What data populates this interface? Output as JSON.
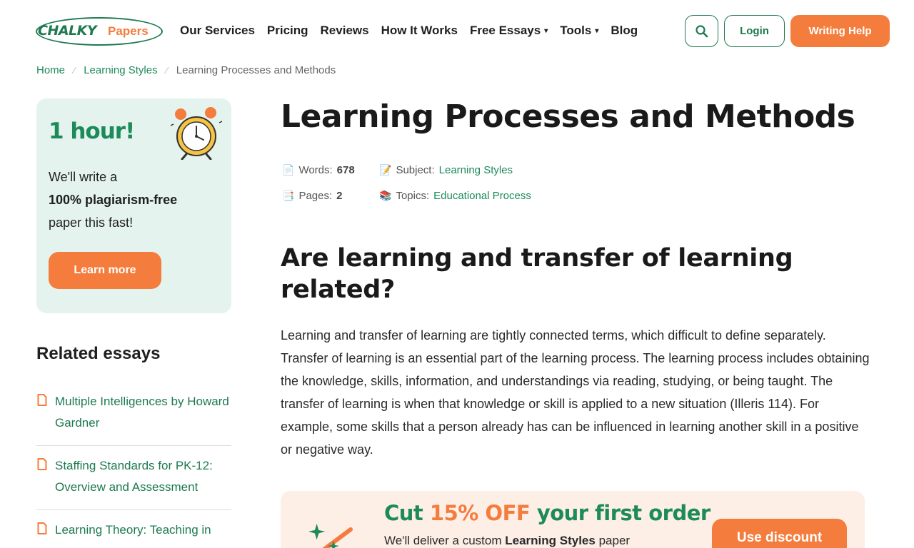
{
  "brand": {
    "logo_main": "CHALKY",
    "logo_sub": "Papers"
  },
  "nav": {
    "items": [
      {
        "label": "Our Services",
        "dropdown": false
      },
      {
        "label": "Pricing",
        "dropdown": false
      },
      {
        "label": "Reviews",
        "dropdown": false
      },
      {
        "label": "How It Works",
        "dropdown": false
      },
      {
        "label": "Free Essays",
        "dropdown": true
      },
      {
        "label": "Tools",
        "dropdown": true
      },
      {
        "label": "Blog",
        "dropdown": false
      }
    ],
    "search_icon": "search-icon",
    "login_label": "Login",
    "writing_help_label": "Writing Help"
  },
  "breadcrumb": {
    "home": "Home",
    "category": "Learning Styles",
    "current": "Learning Processes and Methods"
  },
  "promo": {
    "headline": "1 hour!",
    "line1": "We'll write a",
    "line2": "100% plagiarism-free",
    "line3": "paper this fast!",
    "button": "Learn more",
    "icon": "alarm-clock-icon"
  },
  "related": {
    "title": "Related essays",
    "items": [
      "Multiple Intelligences by Howard Gardner",
      "Staffing Standards for PK-12: Overview and Assessment",
      "Learning Theory: Teaching in"
    ]
  },
  "article": {
    "title": "Learning Processes and Methods",
    "meta": {
      "words_label": "Words:",
      "words_value": "678",
      "pages_label": "Pages:",
      "pages_value": "2",
      "subject_label": "Subject:",
      "subject_value": "Learning Styles",
      "topics_label": "Topics:",
      "topics_value": "Educational Process"
    },
    "heading": "Are learning and transfer of learning related?",
    "paragraph": "Learning and transfer of learning are tightly connected terms, which difficult to define separately. Transfer of learning is an essential part of the learning process. The learning process includes obtaining the knowledge, skills, information, and understandings via reading, studying, or being taught. The transfer of learning is when that knowledge or skill is applied to a new situation (Illeris 114). For example, some skills that a person already has can be influenced in learning another skill in a positive or negative way."
  },
  "discount": {
    "cut": "Cut",
    "percent": "15% OFF",
    "rest": "your first order",
    "deliver_pre": "We'll deliver a custom",
    "deliver_bold": "Learning Styles",
    "deliver_post": "paper",
    "button": "Use discount"
  },
  "colors": {
    "green": "#1d8a5a",
    "orange": "#f47c3c",
    "mint": "#e4f3ee",
    "peach": "#fdeee6"
  }
}
